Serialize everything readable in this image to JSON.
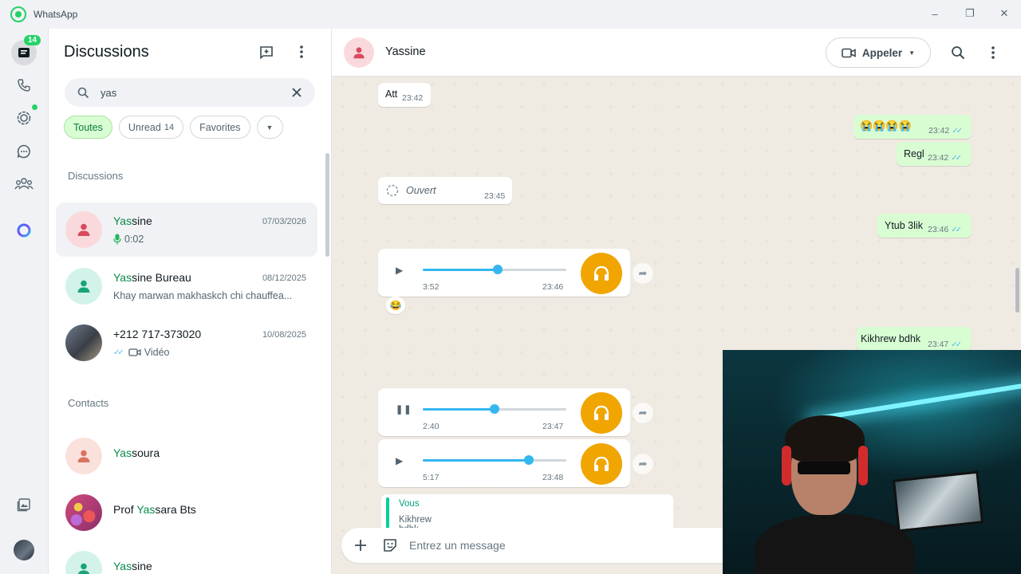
{
  "window": {
    "title": "WhatsApp"
  },
  "rail": {
    "chats_badge": "14"
  },
  "list": {
    "title": "Discussions",
    "search_value": "yas",
    "chips": [
      {
        "label": "Toutes"
      },
      {
        "label": "Unread",
        "count": "14"
      },
      {
        "label": "Favorites"
      }
    ],
    "section_chats": "Discussions",
    "section_contacts": "Contacts",
    "chats": [
      {
        "name_match": "Yas",
        "name_rest": "sine",
        "date": "07/03/2026",
        "subtitle": "0:02"
      },
      {
        "name_match": "Yas",
        "name_rest": "sine Bureau",
        "date": "08/12/2025",
        "subtitle": "Khay marwan makhaskch chi chauffea..."
      },
      {
        "name_pre": "+212 717-373020",
        "date": "10/08/2025",
        "subtitle": "Vidéo"
      }
    ],
    "contacts": [
      {
        "name_match": "Yas",
        "name_rest": "soura"
      },
      {
        "name_pre": "Prof ",
        "name_match": "Yas",
        "name_rest": "sara Bts"
      },
      {
        "name_match": "Yas",
        "name_rest": "sine"
      }
    ]
  },
  "conversation": {
    "contact_name": "Yassine",
    "call_label": "Appeler",
    "messages": [
      {
        "text": "Att",
        "time": "23:42"
      },
      {
        "text": "😭😭😭😭",
        "time": "23:42"
      },
      {
        "text": "Regl",
        "time": "23:42"
      },
      {
        "text": "Ouvert",
        "time": "23:45"
      },
      {
        "text": "Ytub 3lik",
        "time": "23:46"
      },
      {
        "text": "Kikhrew bdhk",
        "time": "23:47"
      }
    ],
    "voice_notes": [
      {
        "duration": "3:52",
        "time": "23:46",
        "progress": 0.52,
        "reaction": "😂"
      },
      {
        "duration": "2:40",
        "time": "23:47",
        "progress": 0.5
      },
      {
        "duration": "5:17",
        "time": "23:48",
        "progress": 0.74
      }
    ],
    "quote": {
      "author": "Vous",
      "text": "Kikhrew bdhk"
    },
    "compose_placeholder": "Entrez un message"
  }
}
